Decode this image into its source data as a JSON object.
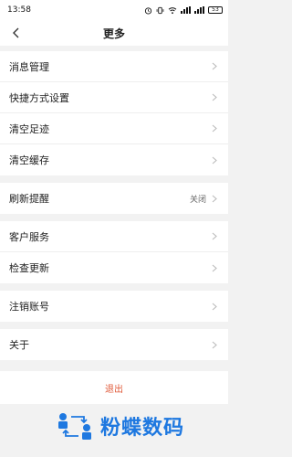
{
  "status": {
    "time": "13:58",
    "battery": "53"
  },
  "header": {
    "title": "更多"
  },
  "groups": [
    {
      "items": [
        {
          "label": "消息管理"
        },
        {
          "label": "快捷方式设置"
        },
        {
          "label": "清空足迹"
        },
        {
          "label": "清空缓存"
        }
      ]
    },
    {
      "items": [
        {
          "label": "刷新提醒",
          "value": "关闭"
        }
      ]
    },
    {
      "items": [
        {
          "label": "客户服务"
        },
        {
          "label": "检查更新"
        }
      ]
    },
    {
      "items": [
        {
          "label": "注销账号"
        }
      ]
    },
    {
      "items": [
        {
          "label": "关于"
        }
      ]
    }
  ],
  "logout": {
    "label": "退出"
  },
  "watermark": {
    "text": "粉蝶数码"
  },
  "colors": {
    "accent": "#e05a3a",
    "watermark": "#1e78e0",
    "background": "#f2f2f2"
  },
  "icons": {
    "back": "chevron-left-icon",
    "row_arrow": "chevron-right-icon"
  }
}
